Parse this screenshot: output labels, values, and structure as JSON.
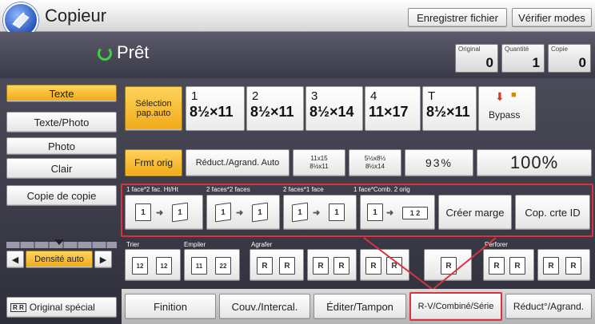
{
  "header": {
    "title": "Copieur",
    "save_file": "Enregistrer fichier",
    "check_modes": "Vérifier modes"
  },
  "status": {
    "text": "Prêt",
    "counters": [
      {
        "label": "Original",
        "value": "0"
      },
      {
        "label": "Quantité",
        "value": "1"
      },
      {
        "label": "Copie",
        "value": "0"
      }
    ]
  },
  "modes": [
    {
      "label": "Texte",
      "selected": true
    },
    {
      "label": "Texte/Photo",
      "selected": false
    },
    {
      "label": "Photo",
      "selected": false
    },
    {
      "label": "Clair",
      "selected": false
    },
    {
      "label": "Copie de copie",
      "selected": false
    }
  ],
  "paper": {
    "select_label": "Sélection pap.auto",
    "trays": [
      {
        "n": "1",
        "size": "8½×11"
      },
      {
        "n": "2",
        "size": "8½×11"
      },
      {
        "n": "3",
        "size": "8½×14"
      },
      {
        "n": "4",
        "size": "11×17"
      },
      {
        "n": "T",
        "size": "8½×11"
      }
    ],
    "bypass": "Bypass"
  },
  "reduce": {
    "frmt_orig": "Frmt orig",
    "auto": "Réduct./Agrand. Auto",
    "preset1_top": "11x15",
    "preset1_bot": "8½x11",
    "preset2_top": "5½x8½",
    "preset2_bot": "8½x14",
    "pct": "93%",
    "full": "100%"
  },
  "duplex": {
    "labels": [
      "1 face*2 fac. Ht/Ht",
      "2 faces*2 faces",
      "2 faces*1 face",
      "1 face*Comb. 2 orig"
    ],
    "margin": "Créer marge",
    "id_card": "Cop. crte ID"
  },
  "finishing_labels": {
    "sort": "Trier",
    "stack": "Empiler",
    "staple": "Agrafer",
    "punch": "Perforer"
  },
  "density": {
    "label": "Densité auto"
  },
  "special": "Original spécial",
  "tabs": [
    "Finition",
    "Couv./Intercal.",
    "Éditer/Tampon",
    "R-V/Combiné/Série",
    "Réduct°/Agrand."
  ],
  "colors": {
    "highlight": "#d9333f",
    "selected": "#f4b828",
    "header_dark": "#3d3d4a"
  }
}
